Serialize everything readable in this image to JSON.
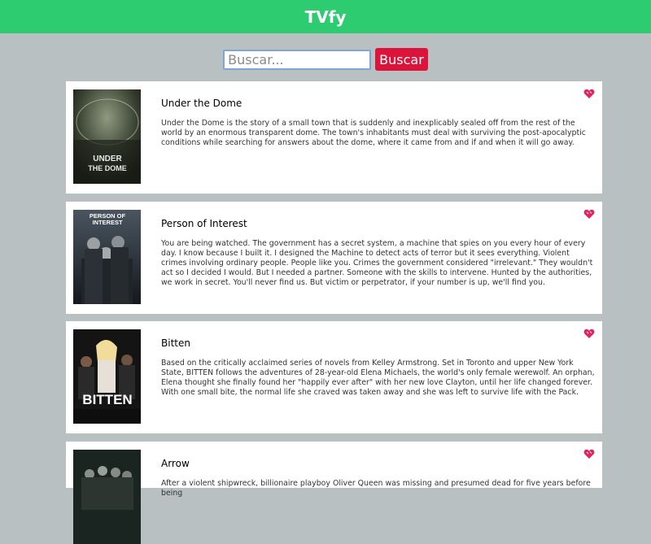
{
  "header": {
    "title": "TVfy"
  },
  "search": {
    "placeholder": "Buscar...",
    "value": "",
    "button_label": "Buscar"
  },
  "shows": [
    {
      "title": "Under the Dome",
      "poster_text": "UNDER THE DOME",
      "description": "Under the Dome is the story of a small town that is suddenly and inexplicably sealed off from the rest of the world by an enormous transparent dome. The town's inhabitants must deal with surviving the post-apocalyptic conditions while searching for answers about the dome, where it came from and if and when it will go away."
    },
    {
      "title": "Person of Interest",
      "poster_text": "PERSON OF INTEREST",
      "description": "You are being watched. The government has a secret system, a machine that spies on you every hour of every day. I know because I built it. I designed the Machine to detect acts of terror but it sees everything. Violent crimes involving ordinary people. People like you. Crimes the government considered \"irrelevant.\" They wouldn't act so I decided I would. But I needed a partner. Someone with the skills to intervene. Hunted by the authorities, we work in secret. You'll never find us. But victim or perpetrator, if your number is up, we'll find you."
    },
    {
      "title": "Bitten",
      "poster_text": "BITTEN",
      "description": "Based on the critically acclaimed series of novels from Kelley Armstrong. Set in Toronto and upper New York State, BITTEN follows the adventures of 28-year-old Elena Michaels, the world's only female werewolf. An orphan, Elena thought she finally found her \"happily ever after\" with her new love Clayton, until her life changed forever. With one small bite, the normal life she craved was taken away and she was left to survive life with the Pack."
    },
    {
      "title": "Arrow",
      "poster_text": "",
      "description": "After a violent shipwreck, billionaire playboy Oliver Queen was missing and presumed dead for five years before being"
    }
  ],
  "colors": {
    "header": "#2ecc71",
    "button": "#dc143c",
    "background": "#b9c0c2",
    "favorite": "#e0245e"
  }
}
